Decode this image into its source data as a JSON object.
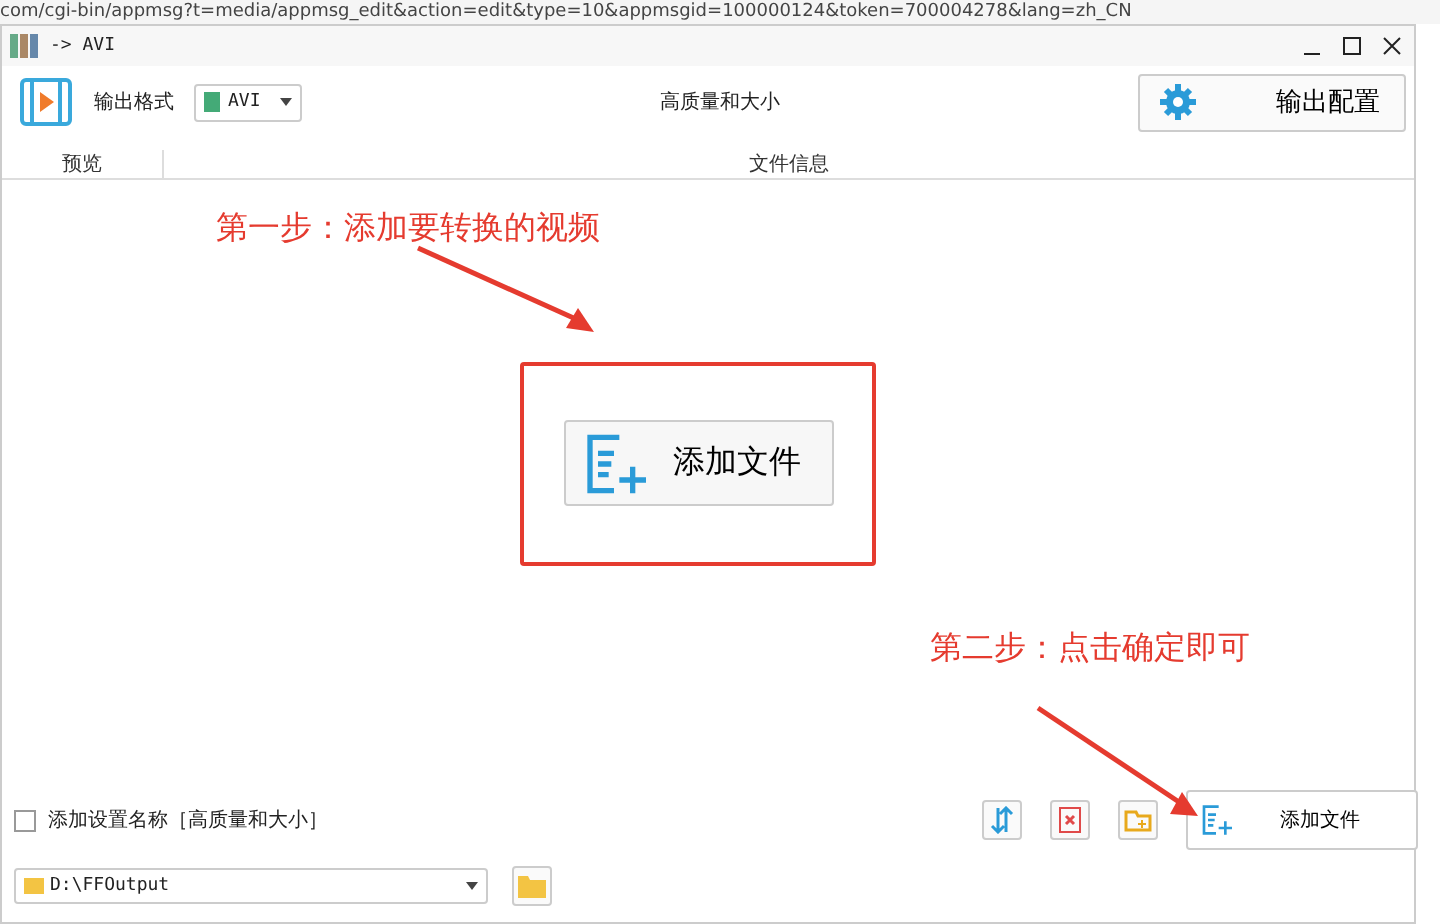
{
  "browser_url": "com/cgi-bin/appmsg?t=media/appmsg_edit&action=edit&type=10&appmsgid=100000124&token=700004278&lang=zh_CN",
  "window": {
    "title": "-> AVI"
  },
  "toolbar": {
    "format_label": "输出格式",
    "format_value": "AVI",
    "preset": "高质量和大小",
    "config_button": "输出配置"
  },
  "file_list": {
    "columns": [
      "预览",
      "文件信息"
    ],
    "add_button": "添加文件"
  },
  "annotations": [
    {
      "text": "第一步：添加要转换的视频"
    },
    {
      "text": "第二步：点击确定即可"
    }
  ],
  "bottom": {
    "save_preset": {
      "label": "添加设置名称［高质量和大小］",
      "checked": false
    },
    "add_button": "添加文件",
    "output_path": "D:\\FFOutput"
  }
}
